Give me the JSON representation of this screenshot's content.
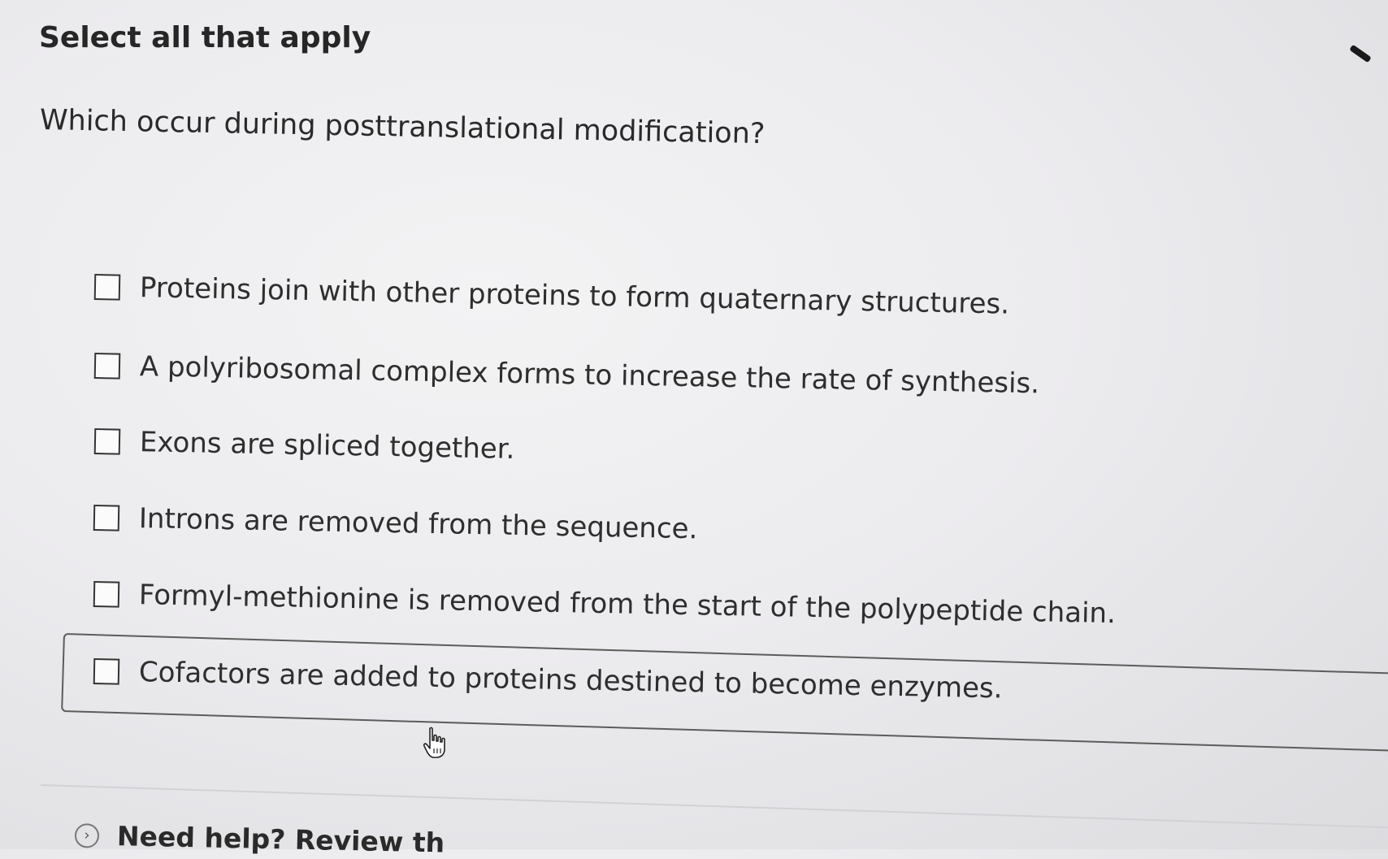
{
  "instruction": "Select all that apply",
  "question": "Which occur during posttranslational modification?",
  "options": [
    {
      "label": "Proteins join with other proteins to form quaternary structures.",
      "checked": false
    },
    {
      "label": "A polyribosomal complex forms to increase the rate of synthesis.",
      "checked": false
    },
    {
      "label": "Exons are spliced together.",
      "checked": false
    },
    {
      "label": "Introns are removed from the sequence.",
      "checked": false
    },
    {
      "label": "Formyl-methionine is removed from the start of the polypeptide chain.",
      "checked": false
    },
    {
      "label": "Cofactors are added to proteins destined to become enzymes.",
      "checked": false
    }
  ],
  "help": {
    "icon": "chevron-right-circle-icon",
    "text": "Need help? Review th"
  },
  "colors": {
    "text": "#2a2a2a",
    "checkbox_border": "#333333",
    "focus_outline": "#5c5c5c"
  }
}
